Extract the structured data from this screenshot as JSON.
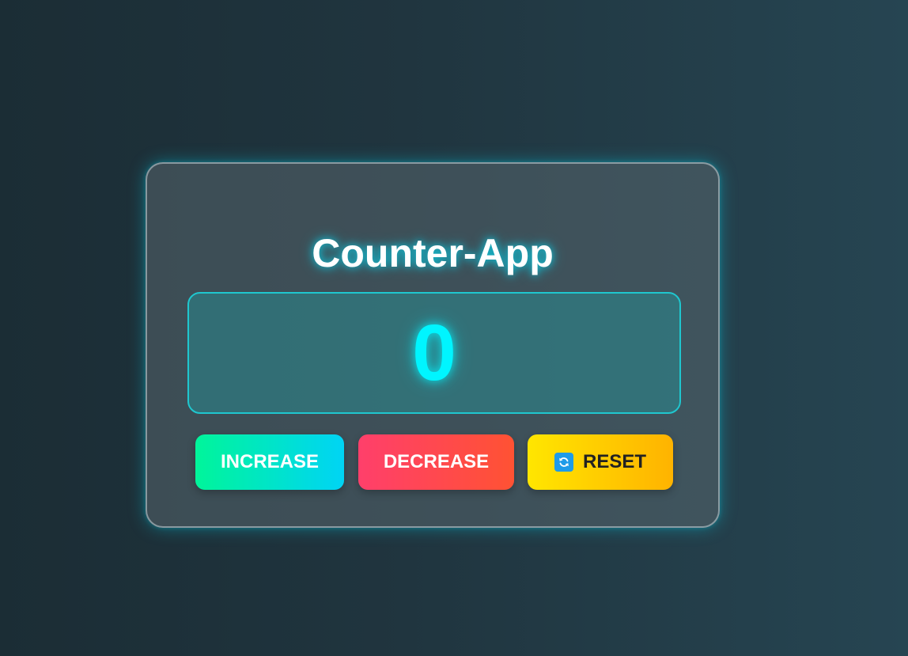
{
  "app": {
    "title": "Counter-App",
    "count": "0"
  },
  "buttons": {
    "increase_label": "INCREASE",
    "decrease_label": "DECREASE",
    "reset_label": "RESET",
    "reset_icon": "refresh-icon"
  },
  "colors": {
    "count_color": "#00f5ff",
    "increase_gradient": [
      "#00f59a",
      "#00d4f5"
    ],
    "decrease_gradient": [
      "#ff3f6b",
      "#ff5233"
    ],
    "reset_gradient": [
      "#ffe600",
      "#ffb300"
    ]
  }
}
